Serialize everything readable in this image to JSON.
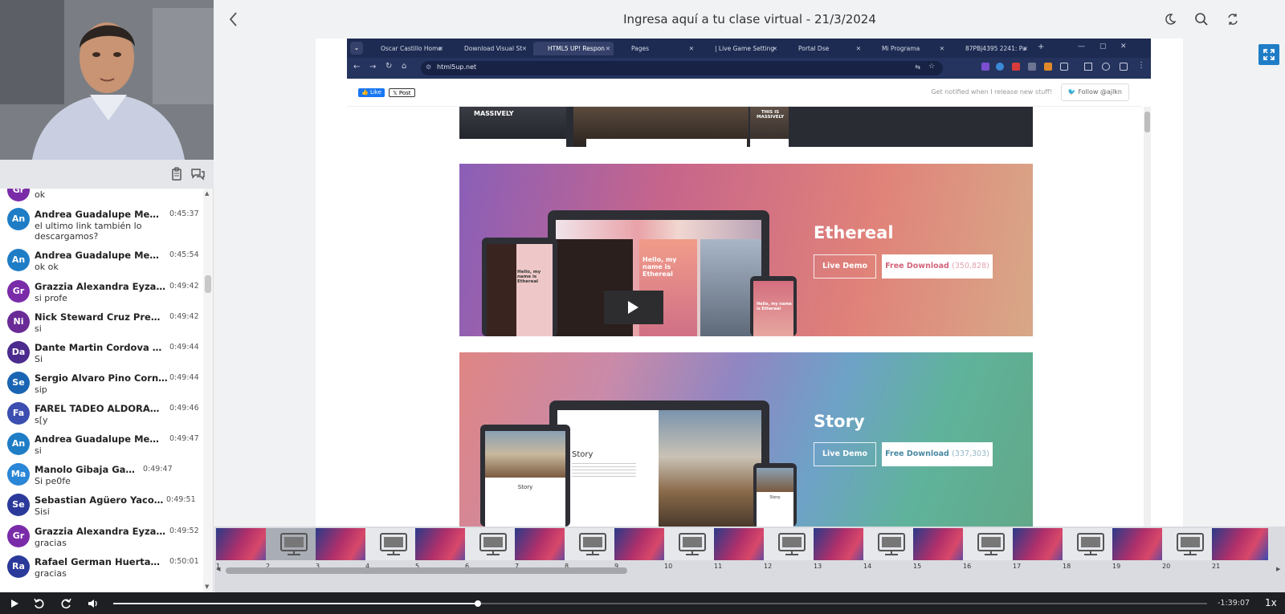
{
  "header": {
    "title": "Ingresa aquí a tu clase virtual - 21/3/2024",
    "back_icon": "chevron-left-icon",
    "icons": [
      "moon-icon",
      "search-icon",
      "swap-icon",
      "fullscreen-icon"
    ]
  },
  "chat": {
    "top_partial_text": "ok",
    "top_partial_initials": "Gr",
    "messages": [
      {
        "initials": "An",
        "name": "Andrea Guadalupe Mena...",
        "time": "0:45:37",
        "text": "el ultimo link también lo descargamos?",
        "color": "#1f7dc6"
      },
      {
        "initials": "An",
        "name": "Andrea Guadalupe Mena...",
        "time": "0:45:54",
        "text": "ok ok",
        "color": "#1f7dc6"
      },
      {
        "initials": "Gr",
        "name": "Grazzia Alexandra Eyzag...",
        "time": "0:49:42",
        "text": "si profe",
        "color": "#7a2ca8"
      },
      {
        "initials": "Ni",
        "name": "Nick Steward Cruz Precia...",
        "time": "0:49:42",
        "text": "si",
        "color": "#6a2b96"
      },
      {
        "initials": "Da",
        "name": "Dante Martin Cordova M...",
        "time": "0:49:44",
        "text": "Si",
        "color": "#4c2b8e"
      },
      {
        "initials": "Se",
        "name": "Sergio Alvaro Pino Cornejo",
        "time": "0:49:44",
        "text": "sip",
        "color": "#1a65b3"
      },
      {
        "initials": "Fa",
        "name": "FAREL TADEO ALDORADI...",
        "time": "0:49:46",
        "text": "s[y",
        "color": "#3c4eb0"
      },
      {
        "initials": "An",
        "name": "Andrea Guadalupe Mena...",
        "time": "0:49:47",
        "text": "si",
        "color": "#1f7dc6"
      },
      {
        "initials": "Ma",
        "name": "Manolo Gibaja Gaona",
        "time": "0:49:47",
        "text": "Si pe0fe",
        "color": "#2a86d6"
      },
      {
        "initials": "Se",
        "name": "Sebastian Agüero Yacolca",
        "time": "0:49:51",
        "text": "Sisi",
        "color": "#2b3a9a"
      },
      {
        "initials": "Gr",
        "name": "Grazzia Alexandra Eyzag...",
        "time": "0:49:52",
        "text": "gracias",
        "color": "#7a2ca8"
      },
      {
        "initials": "Ra",
        "name": "Rafael German Huertas ...",
        "time": "0:50:01",
        "text": "gracias",
        "color": "#2b3a9a"
      }
    ]
  },
  "browser": {
    "tabs": [
      "Oscar Castillo Home",
      "Download Visual St",
      "HTML5 UP! Respon",
      "Pages",
      "| Live Game Setting",
      "Portal Dse",
      "Mi Programa",
      "87PBj4395 2241: Pa"
    ],
    "active_tab": 2,
    "url": "html5up.net",
    "like_label": "Like",
    "post_label": "Post",
    "notify_text": "Get notified when I release new stuff!",
    "follow_label": "Follow @ajlkn"
  },
  "templates": [
    {
      "name": "Ethereal",
      "live_demo": "Live Demo",
      "download": "Free Download",
      "count": "(350,828)",
      "mock_heading": "Hello, my name is Ethereal",
      "mock_small": "Hello, my name is Ethereal"
    },
    {
      "name": "Story",
      "live_demo": "Live Demo",
      "download": "Free Download",
      "count": "(337,303)",
      "mock_heading": "Story",
      "mock_small": "Story"
    }
  ],
  "top_card_labels": [
    "MASSIVELY",
    "THIS IS MASSIVELY"
  ],
  "filmstrip": {
    "numbers": [
      "1",
      "2",
      "3",
      "4",
      "5",
      "6",
      "7",
      "8",
      "9",
      "10",
      "11",
      "12",
      "13",
      "14",
      "15",
      "16",
      "17",
      "18",
      "19",
      "20",
      "21"
    ],
    "selected_index": 1
  },
  "player": {
    "remaining": "-1:39:07",
    "speed": "1x",
    "progress": 0.333
  },
  "colors": {
    "accent": "#1f7dc6",
    "browser_dark": "#1d2b52"
  }
}
